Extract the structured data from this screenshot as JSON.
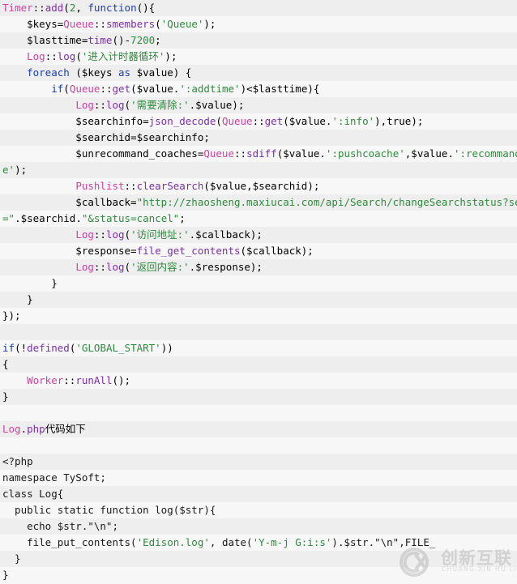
{
  "document": {
    "kind": "code-listing",
    "language": "php",
    "background_odd": "#eeeeee",
    "background_even": "#f7f7f7",
    "colors": {
      "class": "#d040a0",
      "function": "#7a2fa8",
      "keyword": "#1a3faa",
      "string": "#2e8b3d",
      "number": "#2e8b3d",
      "plain": "#000000"
    }
  },
  "lines": [
    {
      "tokens": [
        {
          "t": "Timer",
          "c": "cls"
        },
        {
          "t": "::",
          "c": "plain"
        },
        {
          "t": "add",
          "c": "fn"
        },
        {
          "t": "(",
          "c": "plain"
        },
        {
          "t": "2",
          "c": "num"
        },
        {
          "t": ", ",
          "c": "plain"
        },
        {
          "t": "function",
          "c": "kw"
        },
        {
          "t": "(){",
          "c": "plain"
        }
      ]
    },
    {
      "tokens": [
        {
          "t": "    $keys=",
          "c": "plain"
        },
        {
          "t": "Queue",
          "c": "cls"
        },
        {
          "t": "::",
          "c": "plain"
        },
        {
          "t": "smembers",
          "c": "fn"
        },
        {
          "t": "(",
          "c": "plain"
        },
        {
          "t": "'Queue'",
          "c": "str"
        },
        {
          "t": ");",
          "c": "plain"
        }
      ]
    },
    {
      "tokens": [
        {
          "t": "    $lasttime=",
          "c": "plain"
        },
        {
          "t": "time",
          "c": "fn"
        },
        {
          "t": "()-",
          "c": "plain"
        },
        {
          "t": "7200",
          "c": "num"
        },
        {
          "t": ";",
          "c": "plain"
        }
      ]
    },
    {
      "tokens": [
        {
          "t": "    ",
          "c": "plain"
        },
        {
          "t": "Log",
          "c": "cls"
        },
        {
          "t": "::",
          "c": "plain"
        },
        {
          "t": "log",
          "c": "fn"
        },
        {
          "t": "(",
          "c": "plain"
        },
        {
          "t": "'进入计时器循环'",
          "c": "str"
        },
        {
          "t": ");",
          "c": "plain"
        }
      ]
    },
    {
      "tokens": [
        {
          "t": "    ",
          "c": "plain"
        },
        {
          "t": "foreach",
          "c": "kw"
        },
        {
          "t": " ($keys ",
          "c": "plain"
        },
        {
          "t": "as",
          "c": "kw"
        },
        {
          "t": " $value) {",
          "c": "plain"
        }
      ]
    },
    {
      "tokens": [
        {
          "t": "        ",
          "c": "plain"
        },
        {
          "t": "if",
          "c": "kw"
        },
        {
          "t": "(",
          "c": "plain"
        },
        {
          "t": "Queue",
          "c": "cls"
        },
        {
          "t": "::",
          "c": "plain"
        },
        {
          "t": "get",
          "c": "fn"
        },
        {
          "t": "($value.",
          "c": "plain"
        },
        {
          "t": "':addtime'",
          "c": "str"
        },
        {
          "t": ")<$lasttime){",
          "c": "plain"
        }
      ]
    },
    {
      "tokens": [
        {
          "t": "            ",
          "c": "plain"
        },
        {
          "t": "Log",
          "c": "cls"
        },
        {
          "t": "::",
          "c": "plain"
        },
        {
          "t": "log",
          "c": "fn"
        },
        {
          "t": "(",
          "c": "plain"
        },
        {
          "t": "'需要清除:'",
          "c": "str"
        },
        {
          "t": ".$value);",
          "c": "plain"
        }
      ]
    },
    {
      "tokens": [
        {
          "t": "            $searchinfo=",
          "c": "plain"
        },
        {
          "t": "json_decode",
          "c": "fn"
        },
        {
          "t": "(",
          "c": "plain"
        },
        {
          "t": "Queue",
          "c": "cls"
        },
        {
          "t": "::",
          "c": "plain"
        },
        {
          "t": "get",
          "c": "fn"
        },
        {
          "t": "($value.",
          "c": "plain"
        },
        {
          "t": "':info'",
          "c": "str"
        },
        {
          "t": "),",
          "c": "plain"
        },
        {
          "t": "true",
          "c": "plain"
        },
        {
          "t": ");",
          "c": "plain"
        }
      ]
    },
    {
      "tokens": [
        {
          "t": "            $searchid=$searchinfo;",
          "c": "plain"
        }
      ]
    },
    {
      "tokens": [
        {
          "t": "            $unrecommand_coaches=",
          "c": "plain"
        },
        {
          "t": "Queue",
          "c": "cls"
        },
        {
          "t": "::",
          "c": "plain"
        },
        {
          "t": "sdiff",
          "c": "fn"
        },
        {
          "t": "($value.",
          "c": "plain"
        },
        {
          "t": "':pushcoache'",
          "c": "str"
        },
        {
          "t": ",$value.",
          "c": "plain"
        },
        {
          "t": "':recommandcoach",
          "c": "str"
        }
      ],
      "wrap": {
        "tokens": [
          {
            "t": "e'",
            "c": "str"
          },
          {
            "t": ");",
            "c": "plain"
          }
        ]
      }
    },
    {
      "tokens": [
        {
          "t": "            ",
          "c": "plain"
        },
        {
          "t": "Pushlist",
          "c": "cls"
        },
        {
          "t": "::",
          "c": "plain"
        },
        {
          "t": "clearSearch",
          "c": "fn"
        },
        {
          "t": "($value,$searchid);",
          "c": "plain"
        }
      ]
    },
    {
      "tokens": [
        {
          "t": "            $callback=",
          "c": "plain"
        },
        {
          "t": "\"http://zhaosheng.maxiucai.com/api/Search/changeSearchstatus?searchid",
          "c": "str"
        }
      ],
      "wrap": {
        "tokens": [
          {
            "t": "=\"",
            "c": "str"
          },
          {
            "t": ".$searchid.",
            "c": "plain"
          },
          {
            "t": "\"&status=cancel\"",
            "c": "str"
          },
          {
            "t": ";",
            "c": "plain"
          }
        ]
      }
    },
    {
      "tokens": [
        {
          "t": "            ",
          "c": "plain"
        },
        {
          "t": "Log",
          "c": "cls"
        },
        {
          "t": "::",
          "c": "plain"
        },
        {
          "t": "log",
          "c": "fn"
        },
        {
          "t": "(",
          "c": "plain"
        },
        {
          "t": "'访问地址:'",
          "c": "str"
        },
        {
          "t": ".$callback);",
          "c": "plain"
        }
      ]
    },
    {
      "tokens": [
        {
          "t": "            $response=",
          "c": "plain"
        },
        {
          "t": "file_get_contents",
          "c": "fn"
        },
        {
          "t": "($callback);",
          "c": "plain"
        }
      ]
    },
    {
      "tokens": [
        {
          "t": "            ",
          "c": "plain"
        },
        {
          "t": "Log",
          "c": "cls"
        },
        {
          "t": "::",
          "c": "plain"
        },
        {
          "t": "log",
          "c": "fn"
        },
        {
          "t": "(",
          "c": "plain"
        },
        {
          "t": "'返回内容:'",
          "c": "str"
        },
        {
          "t": ".$response);",
          "c": "plain"
        }
      ]
    },
    {
      "tokens": [
        {
          "t": "        }",
          "c": "plain"
        }
      ]
    },
    {
      "tokens": [
        {
          "t": "    }",
          "c": "plain"
        }
      ]
    },
    {
      "tokens": [
        {
          "t": "});",
          "c": "plain"
        }
      ]
    },
    {
      "tokens": [
        {
          "t": "",
          "c": "plain"
        }
      ]
    },
    {
      "tokens": [
        {
          "t": "if",
          "c": "kw"
        },
        {
          "t": "(!",
          "c": "plain"
        },
        {
          "t": "defined",
          "c": "fn"
        },
        {
          "t": "(",
          "c": "plain"
        },
        {
          "t": "'GLOBAL_START'",
          "c": "str"
        },
        {
          "t": "))",
          "c": "plain"
        }
      ]
    },
    {
      "tokens": [
        {
          "t": "{",
          "c": "plain"
        }
      ]
    },
    {
      "tokens": [
        {
          "t": "    ",
          "c": "plain"
        },
        {
          "t": "Worker",
          "c": "cls"
        },
        {
          "t": "::",
          "c": "plain"
        },
        {
          "t": "runAll",
          "c": "fn"
        },
        {
          "t": "();",
          "c": "plain"
        }
      ]
    },
    {
      "tokens": [
        {
          "t": "}",
          "c": "plain"
        }
      ]
    },
    {
      "tokens": [
        {
          "t": "",
          "c": "plain"
        }
      ]
    },
    {
      "tokens": [
        {
          "t": "Log",
          "c": "cls"
        },
        {
          "t": ".",
          "c": "plain"
        },
        {
          "t": "php",
          "c": "fn"
        },
        {
          "t": "代码如下",
          "c": "plain"
        }
      ]
    },
    {
      "tokens": [
        {
          "t": "",
          "c": "plain"
        }
      ]
    },
    {
      "tokens": [
        {
          "t": "<?php",
          "c": "none"
        }
      ]
    },
    {
      "tokens": [
        {
          "t": "namespace TySoft;",
          "c": "none"
        }
      ]
    },
    {
      "tokens": [
        {
          "t": "class Log{",
          "c": "none"
        }
      ]
    },
    {
      "tokens": [
        {
          "t": "  public static function log($str){",
          "c": "none"
        }
      ]
    },
    {
      "tokens": [
        {
          "t": "    echo $str.",
          "c": "none"
        },
        {
          "t": "\"\\n\"",
          "c": "none"
        },
        {
          "t": ";",
          "c": "none"
        }
      ]
    },
    {
      "tokens": [
        {
          "t": "    file_put_contents(",
          "c": "none"
        },
        {
          "t": "'Edison.log'",
          "c": "str"
        },
        {
          "t": ", date(",
          "c": "none"
        },
        {
          "t": "'Y-m-j G:i:s'",
          "c": "str"
        },
        {
          "t": ").$str.",
          "c": "none"
        },
        {
          "t": "\"\\n\"",
          "c": "none"
        },
        {
          "t": ",FILE_",
          "c": "none"
        }
      ]
    },
    {
      "tokens": [
        {
          "t": "  }",
          "c": "none"
        }
      ]
    },
    {
      "tokens": [
        {
          "t": "}",
          "c": "none"
        }
      ]
    }
  ],
  "watermark": {
    "logo_letters": "CX",
    "brand_cn": "创新互联",
    "brand_pinyin": "CHUANG XIN HU LIAN"
  }
}
